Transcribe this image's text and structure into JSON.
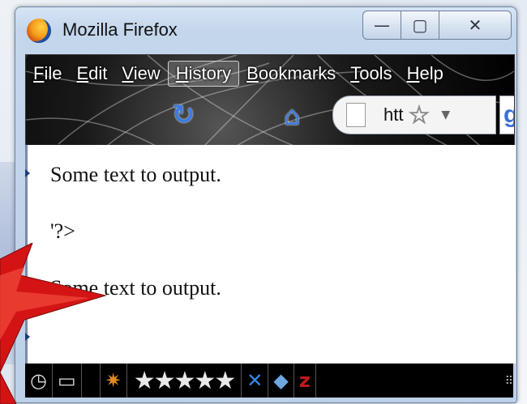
{
  "window": {
    "title": "Mozilla Firefox"
  },
  "window_buttons": {
    "minimize": "—",
    "maximize": "▢",
    "close": "✕"
  },
  "menubar": {
    "items": [
      {
        "label": "File",
        "accel": "F",
        "rest": "ile"
      },
      {
        "label": "Edit",
        "accel": "E",
        "rest": "dit"
      },
      {
        "label": "View",
        "accel": "V",
        "rest": "iew"
      },
      {
        "label": "History",
        "accel": "H",
        "rest": "istory"
      },
      {
        "label": "Bookmarks",
        "accel": "B",
        "rest": "ookmarks"
      },
      {
        "label": "Tools",
        "accel": "T",
        "rest": "ools"
      },
      {
        "label": "Help",
        "accel": "H",
        "rest": "elp"
      }
    ]
  },
  "navbar": {
    "reload_icon": "reload-icon",
    "home_icon": "home-icon",
    "url_text": "htt",
    "bookmark_star": "star-icon",
    "search_engine": "g"
  },
  "content": {
    "lines": [
      "Some text to output.",
      "'?>",
      "Some text to output."
    ]
  },
  "statusbar": {
    "icons": [
      "clock-icon",
      "ruler-icon",
      "firebug-icon",
      "rating-stars",
      "addon-icon",
      "cube-icon",
      "zotero-icon"
    ],
    "stars": "★★★★★",
    "zotero": "z"
  },
  "colors": {
    "accent": "#3d7be0",
    "arrow": "#d41414"
  }
}
